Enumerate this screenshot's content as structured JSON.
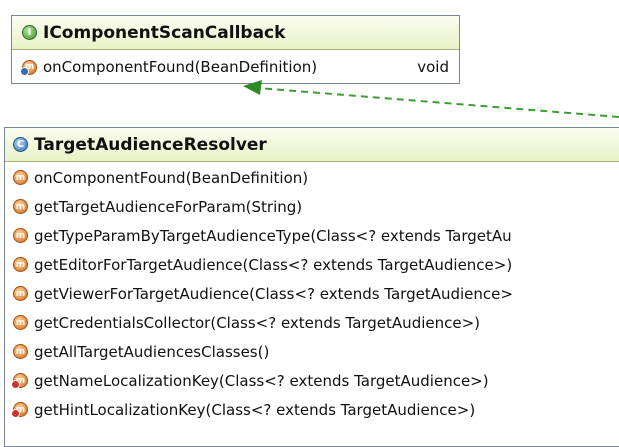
{
  "interface": {
    "icon": "interface-icon",
    "title": "IComponentScanCallback",
    "methods": [
      {
        "icon": "method-implement-icon",
        "signature": "onComponentFound(BeanDefinition)",
        "return_type": "void"
      }
    ]
  },
  "class": {
    "icon": "class-icon",
    "title": "TargetAudienceResolver",
    "methods": [
      {
        "icon": "method-icon",
        "signature": "onComponentFound(BeanDefinition)"
      },
      {
        "icon": "method-icon",
        "signature": "getTargetAudienceForParam(String)"
      },
      {
        "icon": "method-icon",
        "signature": "getTypeParamByTargetAudienceType(Class<? extends TargetAu"
      },
      {
        "icon": "method-icon",
        "signature": "getEditorForTargetAudience(Class<? extends TargetAudience>)"
      },
      {
        "icon": "method-icon",
        "signature": "getViewerForTargetAudience(Class<? extends TargetAudience>"
      },
      {
        "icon": "method-icon",
        "signature": "getCredentialsCollector(Class<? extends TargetAudience>)"
      },
      {
        "icon": "method-icon",
        "signature": "getAllTargetAudiencesClasses()"
      },
      {
        "icon": "method-private-icon",
        "signature": "getNameLocalizationKey(Class<? extends TargetAudience>)"
      },
      {
        "icon": "method-private-icon",
        "signature": "getHintLocalizationKey(Class<? extends TargetAudience>)"
      }
    ]
  },
  "relation": {
    "type": "implements",
    "style": "dashed",
    "color": "#3f9c35"
  },
  "colors": {
    "header_bg": "#e8f2c7",
    "border": "#7b8794",
    "interface_icon": "#3d8f2a",
    "class_icon": "#2f6fb8",
    "method_icon": "#d2681a"
  }
}
